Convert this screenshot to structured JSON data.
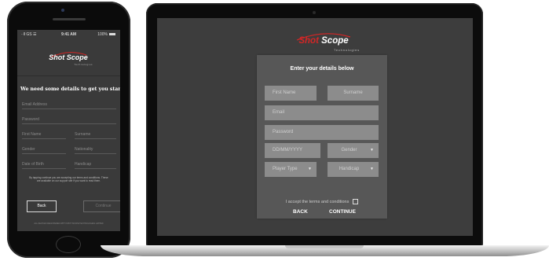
{
  "phone": {
    "status": {
      "signal": "∙∙ll GS ☰",
      "time": "9:41 AM",
      "battery": "100%"
    },
    "logo": {
      "text": "Shot Scope",
      "subtext": "Technologies"
    },
    "heading": "We need some details to get you started",
    "fields": {
      "email": "Email Address",
      "password": "Password",
      "first_name": "First Name",
      "surname": "Surname",
      "gender": "Gender",
      "nationality": "Nationality",
      "dob": "Date of Birth",
      "handicap": "Handicap"
    },
    "legal": "By tapping continue you are accepting our terms and conditions. These are available on our support site if you want to read them.",
    "back_label": "Back",
    "continue_label": "Continue",
    "footer": "ALL DEVICES REGISTERED WITH SHOT SCOPE TECHNOLOGIES LIMITED"
  },
  "laptop": {
    "logo": {
      "text_shot": "Shot",
      "text_scope": "Scope",
      "subtext": "Technologies"
    },
    "title": "Enter your details below",
    "fields": {
      "first_name": "First Name",
      "surname": "Surname",
      "email": "Email",
      "password": "Password",
      "dob": "DD/MM/YYYY",
      "gender": "Gender",
      "player_type": "Player Type",
      "handicap": "Handicap"
    },
    "dropdown_icon": "caret-down",
    "terms": "I accept the terms and conditions",
    "back_label": "BACK",
    "continue_label": "CONTINUE"
  },
  "colors": {
    "accent": "#d32626",
    "panel": "#575757",
    "screen": "#3d3d3d"
  }
}
